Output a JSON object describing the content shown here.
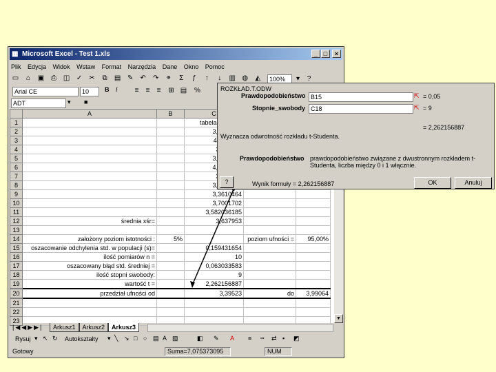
{
  "window": {
    "title": "Microsoft Excel - Test 1.xls"
  },
  "menu": [
    "Plik",
    "Edycja",
    "Widok",
    "Wstaw",
    "Format",
    "Narzędzia",
    "Dane",
    "Okno",
    "Pomoc"
  ],
  "toolbar": {
    "zoom": "100%",
    "font": "Arial CE",
    "size": "10"
  },
  "formula": {
    "name_box": "ADT"
  },
  "columns": [
    "A",
    "B",
    "C"
  ],
  "rows": [
    {
      "n": "1",
      "a": "",
      "c": "tabela wyników"
    },
    {
      "n": "2",
      "a": "",
      "c": "3,9584022"
    },
    {
      "n": "3",
      "a": "",
      "c": "4,1116719"
    },
    {
      "n": "4",
      "a": "",
      "c": "3,841317"
    },
    {
      "n": "5",
      "a": "",
      "c": "3,3921557"
    },
    {
      "n": "6",
      "a": "",
      "c": "4,1410101"
    },
    {
      "n": "7",
      "a": "",
      "c": "3,701906"
    },
    {
      "n": "8",
      "a": "",
      "c": "3,3636362"
    },
    {
      "n": "9",
      "a": "",
      "c": "3,3610464"
    },
    {
      "n": "10",
      "a": "",
      "c": "3,7001702"
    },
    {
      "n": "11",
      "a": "",
      "c": "3,582036185"
    },
    {
      "n": "12",
      "a": "średnia xśr=",
      "c": "3,637953"
    },
    {
      "n": "13",
      "a": "",
      "c": ""
    },
    {
      "n": "14",
      "a": "założony poziom istotności :",
      "b": "5%",
      "c": "",
      "d": "poziom ufności =",
      "e": "95,00%"
    },
    {
      "n": "15",
      "a": "oszacowanie odchylenia std. w populacji (s)=",
      "c": "0,159431654"
    },
    {
      "n": "16",
      "a": "ilość pomiarów n =",
      "c": "10"
    },
    {
      "n": "17",
      "a": "oszacowany błąd std. średniej =",
      "c": "0,063033583"
    },
    {
      "n": "18",
      "a": "ilość stopni swobody:",
      "c": "9"
    },
    {
      "n": "19",
      "a": "wartość t =",
      "c": "2,262156887"
    },
    {
      "n": "20",
      "a": "przedział ufności od",
      "c": "3,39523",
      "d": "do",
      "e": "3,99064"
    },
    {
      "n": "21",
      "a": "",
      "c": ""
    },
    {
      "n": "22",
      "a": "",
      "c": ""
    },
    {
      "n": "23",
      "a": "",
      "c": ""
    }
  ],
  "sheets": [
    "Arkusz1",
    "Arkusz2",
    "Arkusz3"
  ],
  "drawing": {
    "draw_label": "Rysuj",
    "autoshapes_label": "Autokształty"
  },
  "status": {
    "ready": "Gotowy",
    "sum": "Suma=7,075373095",
    "num": "NUM"
  },
  "dialog": {
    "title": "ROZKŁAD.T.ODW",
    "prob_label": "Prawdopodobieństwo",
    "prob_value": "B15",
    "prob_result": "= 0,05",
    "df_label": "Stopnie_swobody",
    "df_value": "C18",
    "df_result": "= 9",
    "total": "= 2,262156887",
    "desc": "Wyznacza odwrotność rozkładu t-Studenta.",
    "arg_title": "Prawdopodobieństwo",
    "arg_desc": "prawdopodobieństwo związane z dwustronnym rozkładem t-Studenta, liczba między 0 i 1 włącznie.",
    "result_label": "Wynik formuły = 2,262156887",
    "ok": "OK",
    "cancel": "Anuluj",
    "help": "?"
  }
}
